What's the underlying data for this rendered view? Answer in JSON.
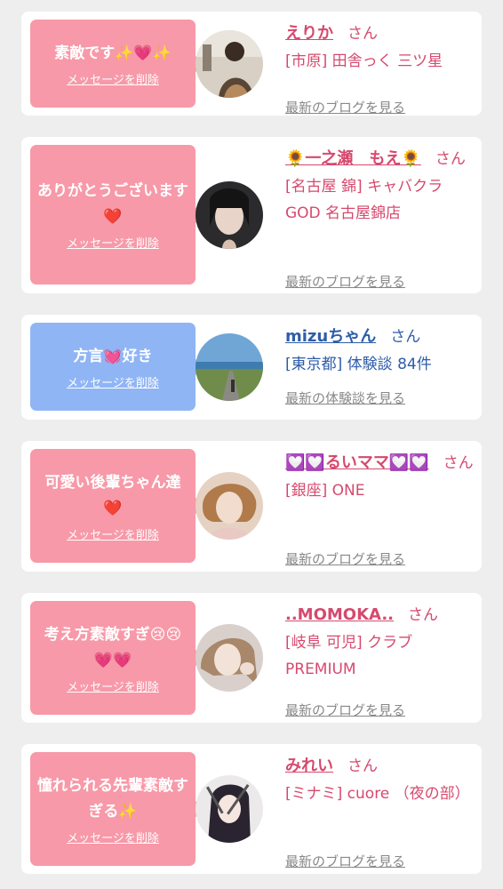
{
  "cards": [
    {
      "message": "素敵です✨💗✨",
      "delete_label": "メッセージを削除",
      "name": "えりか",
      "san": "さん",
      "shop": "[市原] 田舎っく 三ツ星",
      "link": "最新のブログを見る"
    },
    {
      "message": "ありがとうございます❤️",
      "delete_label": "メッセージを削除",
      "name": "🌻一之瀬　もえ🌻",
      "san": "さん",
      "shop": "[名古屋 錦] キャバクラ GOD 名古屋錦店",
      "link": "最新のブログを見る"
    },
    {
      "message": "方言💓好き",
      "delete_label": "メッセージを削除",
      "name": "mizuちゃん",
      "san": "さん",
      "shop": "[東京都] 体験談 84件",
      "link": "最新の体験談を見る"
    },
    {
      "message": "可愛い後輩ちゃん達❤️",
      "delete_label": "メッセージを削除",
      "name": "💟💟るいママ💟💟",
      "san": "さん",
      "shop": "[銀座] ONE",
      "link": "最新のブログを見る"
    },
    {
      "message": "考え方素敵すぎ😢😢💗💗",
      "delete_label": "メッセージを削除",
      "name": "..MOMOKA..",
      "san": "さん",
      "shop": "[岐阜 可児] クラブ PREMIUM",
      "link": "最新のブログを見る"
    },
    {
      "message": "憧れられる先輩素敵すぎる✨",
      "delete_label": "メッセージを削除",
      "name": "みれい",
      "san": "さん",
      "shop": "[ミナミ] cuore （夜の部）",
      "link": "最新のブログを見る"
    }
  ],
  "colors": {
    "pink_bubble": "#f799a8",
    "blue_bubble": "#8fb5f5",
    "pink_text": "#d6496e",
    "blue_text": "#2f5da8",
    "link_gray": "#888888",
    "background": "#eeeeee"
  }
}
